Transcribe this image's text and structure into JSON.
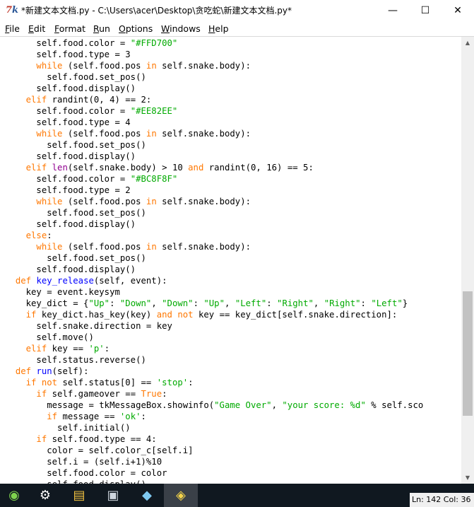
{
  "window": {
    "title": "*新建文本文档.py - C:\\Users\\acer\\Desktop\\贪吃蛇\\新建文本文档.py*",
    "app_icon_text": "7",
    "app_icon_accent": "k",
    "minimize_glyph": "—",
    "maximize_glyph": "☐",
    "close_glyph": "✕"
  },
  "menu": [
    {
      "mnemonic": "F",
      "rest": "ile"
    },
    {
      "mnemonic": "E",
      "rest": "dit"
    },
    {
      "mnemonic": "F",
      "rest": "ormat"
    },
    {
      "mnemonic": "R",
      "rest": "un"
    },
    {
      "mnemonic": "O",
      "rest": "ptions"
    },
    {
      "mnemonic": "W",
      "rest": "indows"
    },
    {
      "mnemonic": "H",
      "rest": "elp"
    }
  ],
  "colors": {
    "keyword": "#ff7700",
    "string": "#00aa00",
    "definition": "#0000ff",
    "builtin": "#900090",
    "taskbar": "#101820"
  },
  "code_lines": [
    [
      [
        "t",
        "      self.food.color = "
      ],
      [
        "s",
        "\"#FFD700\""
      ]
    ],
    [
      [
        "t",
        "      self.food.type = 3"
      ]
    ],
    [
      [
        "t",
        "      "
      ],
      [
        "k",
        "while"
      ],
      [
        "t",
        " (self.food.pos "
      ],
      [
        "k",
        "in"
      ],
      [
        "t",
        " self.snake.body):"
      ]
    ],
    [
      [
        "t",
        "        self.food.set_pos()"
      ]
    ],
    [
      [
        "t",
        "      self.food.display()"
      ]
    ],
    [
      [
        "t",
        "    "
      ],
      [
        "k",
        "elif"
      ],
      [
        "t",
        " randint(0, 4) == 2:"
      ]
    ],
    [
      [
        "t",
        "      self.food.color = "
      ],
      [
        "s",
        "\"#EE82EE\""
      ]
    ],
    [
      [
        "t",
        "      self.food.type = 4"
      ]
    ],
    [
      [
        "t",
        "      "
      ],
      [
        "k",
        "while"
      ],
      [
        "t",
        " (self.food.pos "
      ],
      [
        "k",
        "in"
      ],
      [
        "t",
        " self.snake.body):"
      ]
    ],
    [
      [
        "t",
        "        self.food.set_pos()"
      ]
    ],
    [
      [
        "t",
        "      self.food.display()"
      ]
    ],
    [
      [
        "t",
        "    "
      ],
      [
        "k",
        "elif"
      ],
      [
        "t",
        " "
      ],
      [
        "b",
        "len"
      ],
      [
        "t",
        "(self.snake.body) > 10 "
      ],
      [
        "k",
        "and"
      ],
      [
        "t",
        " randint(0, 16) == 5:"
      ]
    ],
    [
      [
        "t",
        "      self.food.color = "
      ],
      [
        "s",
        "\"#BC8F8F\""
      ]
    ],
    [
      [
        "t",
        "      self.food.type = 2"
      ]
    ],
    [
      [
        "t",
        "      "
      ],
      [
        "k",
        "while"
      ],
      [
        "t",
        " (self.food.pos "
      ],
      [
        "k",
        "in"
      ],
      [
        "t",
        " self.snake.body):"
      ]
    ],
    [
      [
        "t",
        "        self.food.set_pos()"
      ]
    ],
    [
      [
        "t",
        "      self.food.display()"
      ]
    ],
    [
      [
        "t",
        "    "
      ],
      [
        "k",
        "else"
      ],
      [
        "t",
        ":"
      ]
    ],
    [
      [
        "t",
        "      "
      ],
      [
        "k",
        "while"
      ],
      [
        "t",
        " (self.food.pos "
      ],
      [
        "k",
        "in"
      ],
      [
        "t",
        " self.snake.body):"
      ]
    ],
    [
      [
        "t",
        "        self.food.set_pos()"
      ]
    ],
    [
      [
        "t",
        "      self.food.display()"
      ]
    ],
    [
      [
        "t",
        "  "
      ],
      [
        "k",
        "def"
      ],
      [
        "t",
        " "
      ],
      [
        "f",
        "key_release"
      ],
      [
        "t",
        "(self, event):"
      ]
    ],
    [
      [
        "t",
        "    key = event.keysym"
      ]
    ],
    [
      [
        "t",
        "    key_dict = {"
      ],
      [
        "s",
        "\"Up\""
      ],
      [
        "t",
        ": "
      ],
      [
        "s",
        "\"Down\""
      ],
      [
        "t",
        ", "
      ],
      [
        "s",
        "\"Down\""
      ],
      [
        "t",
        ": "
      ],
      [
        "s",
        "\"Up\""
      ],
      [
        "t",
        ", "
      ],
      [
        "s",
        "\"Left\""
      ],
      [
        "t",
        ": "
      ],
      [
        "s",
        "\"Right\""
      ],
      [
        "t",
        ", "
      ],
      [
        "s",
        "\"Right\""
      ],
      [
        "t",
        ": "
      ],
      [
        "s",
        "\"Left\""
      ],
      [
        "t",
        "}"
      ]
    ],
    [
      [
        "t",
        "    "
      ],
      [
        "k",
        "if"
      ],
      [
        "t",
        " key_dict.has_key(key) "
      ],
      [
        "k",
        "and"
      ],
      [
        "t",
        " "
      ],
      [
        "k",
        "not"
      ],
      [
        "t",
        " key == key_dict[self.snake.direction]:"
      ]
    ],
    [
      [
        "t",
        "      self.snake.direction = key"
      ]
    ],
    [
      [
        "t",
        "      self.move()"
      ]
    ],
    [
      [
        "t",
        "    "
      ],
      [
        "k",
        "elif"
      ],
      [
        "t",
        " key == "
      ],
      [
        "s",
        "'p'"
      ],
      [
        "t",
        ":"
      ]
    ],
    [
      [
        "t",
        "      self.status.reverse()"
      ]
    ],
    [
      [
        "t",
        "  "
      ],
      [
        "k",
        "def"
      ],
      [
        "t",
        " "
      ],
      [
        "f",
        "run"
      ],
      [
        "t",
        "(self):"
      ]
    ],
    [
      [
        "t",
        "    "
      ],
      [
        "k",
        "if"
      ],
      [
        "t",
        " "
      ],
      [
        "k",
        "not"
      ],
      [
        "t",
        " self.status[0] == "
      ],
      [
        "s",
        "'stop'"
      ],
      [
        "t",
        ":"
      ]
    ],
    [
      [
        "t",
        "      "
      ],
      [
        "k",
        "if"
      ],
      [
        "t",
        " self.gameover == "
      ],
      [
        "k",
        "True"
      ],
      [
        "t",
        ":"
      ]
    ],
    [
      [
        "t",
        "        message = tkMessageBox.showinfo("
      ],
      [
        "s",
        "\"Game Over\""
      ],
      [
        "t",
        ", "
      ],
      [
        "s",
        "\"your score: %d\""
      ],
      [
        "t",
        " % self.sco"
      ]
    ],
    [
      [
        "t",
        "        "
      ],
      [
        "k",
        "if"
      ],
      [
        "t",
        " message == "
      ],
      [
        "s",
        "'ok'"
      ],
      [
        "t",
        ":"
      ]
    ],
    [
      [
        "t",
        "          self.initial()"
      ]
    ],
    [
      [
        "t",
        "      "
      ],
      [
        "k",
        "if"
      ],
      [
        "t",
        " self.food.type == 4:"
      ]
    ],
    [
      [
        "t",
        "        color = self.color_c[self.i]"
      ]
    ],
    [
      [
        "t",
        "        self.i = (self.i+1)%10"
      ]
    ],
    [
      [
        "t",
        "        self.food.color = color"
      ]
    ],
    [
      [
        "t",
        "        self.food.display()"
      ]
    ]
  ],
  "status": {
    "text": "Ln: 142 Col: 36"
  },
  "scrollbar": {
    "up_glyph": "▲",
    "down_glyph": "▼"
  },
  "taskbar_icons": [
    {
      "name": "start-orb-icon",
      "glyph": "◉"
    },
    {
      "name": "settings-gear-icon",
      "glyph": "⚙"
    },
    {
      "name": "file-explorer-icon",
      "glyph": "▤"
    },
    {
      "name": "app-window-icon",
      "glyph": "▣"
    },
    {
      "name": "notes-app-icon",
      "glyph": "◆"
    },
    {
      "name": "python-idle-icon",
      "glyph": "◈"
    }
  ]
}
